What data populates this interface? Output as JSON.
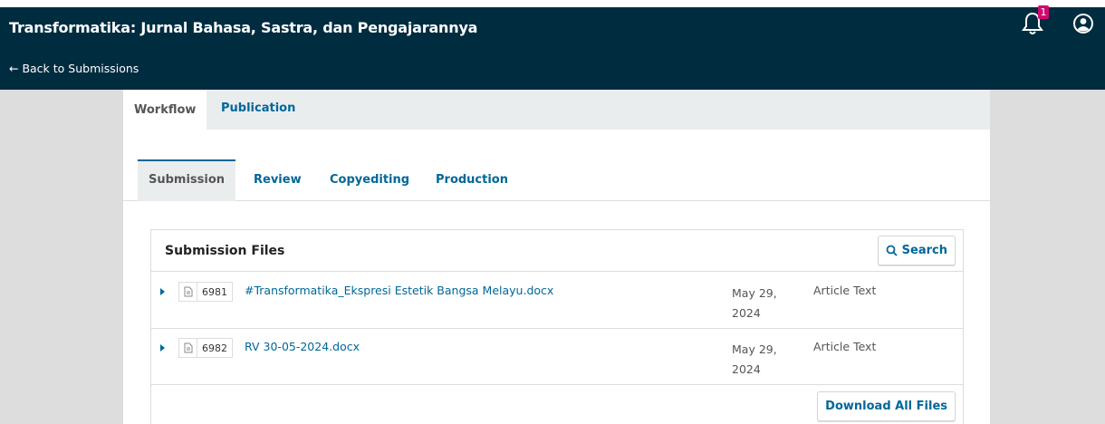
{
  "header": {
    "journal_title": "Transformatika: Jurnal Bahasa, Sastra, dan Pengajarannya",
    "back_link": "← Back to Submissions",
    "notifications_count": "1",
    "icons": [
      "bell-icon",
      "user-icon"
    ],
    "colors": {
      "bar": "#002c40",
      "badge": "#d00a6c"
    }
  },
  "publication_tabs": [
    {
      "label": "Workflow",
      "active": true
    },
    {
      "label": "Publication",
      "active": false
    }
  ],
  "stage_tabs": [
    {
      "label": "Submission",
      "active": true
    },
    {
      "label": "Review",
      "active": false
    },
    {
      "label": "Copyediting",
      "active": false
    },
    {
      "label": "Production",
      "active": false
    }
  ],
  "submission_files": {
    "title": "Submission Files",
    "search_label": "Search",
    "download_all_label": "Download All Files",
    "files": [
      {
        "id": "6981",
        "name": "#Transformatika_Ekspresi Estetik Bangsa Melayu.docx",
        "date_line1": "May 29,",
        "date_line2": "2024",
        "type": "Article Text"
      },
      {
        "id": "6982",
        "name": "RV 30-05-2024.docx",
        "date_line1": "May 29,",
        "date_line2": "2024",
        "type": "Article Text"
      }
    ]
  },
  "accent_color": "#006798"
}
